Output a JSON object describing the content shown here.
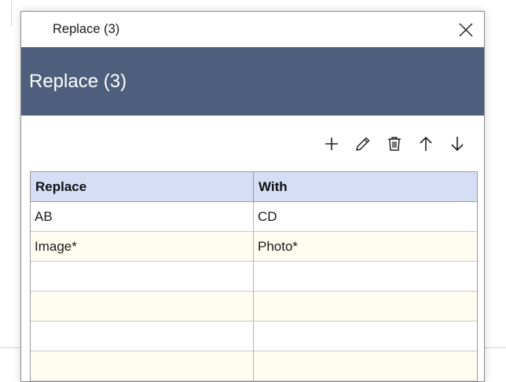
{
  "window": {
    "title": "Replace (3)"
  },
  "header": {
    "title": "Replace (3)"
  },
  "toolbar": {
    "buttons": [
      {
        "name": "add-button",
        "icon": "plus-icon"
      },
      {
        "name": "edit-button",
        "icon": "pencil-icon"
      },
      {
        "name": "delete-button",
        "icon": "trash-icon"
      },
      {
        "name": "move-up-button",
        "icon": "arrow-up-icon"
      },
      {
        "name": "move-down-button",
        "icon": "arrow-down-icon"
      }
    ]
  },
  "table": {
    "columns": [
      "Replace",
      "With"
    ],
    "rows": [
      [
        "AB",
        "CD"
      ],
      [
        "Image*",
        "Photo*"
      ],
      [
        "",
        ""
      ],
      [
        "",
        ""
      ],
      [
        "",
        ""
      ],
      [
        "",
        ""
      ]
    ]
  },
  "colors": {
    "header_band": "#4d5f7d",
    "grid_header": "#d6def6",
    "alt_row": "#fffdf0"
  }
}
